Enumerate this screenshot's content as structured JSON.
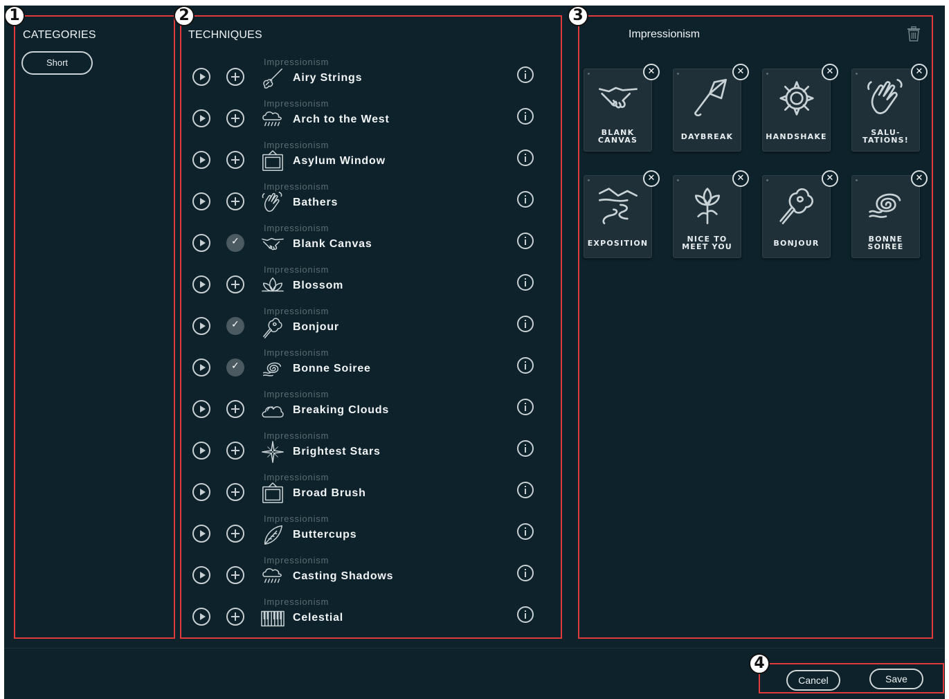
{
  "categories": {
    "title": "CATEGORIES",
    "items": [
      "Short"
    ]
  },
  "techniques": {
    "title": "TECHNIQUES",
    "rows": [
      {
        "category": "Impressionism",
        "name": "Airy Strings",
        "icon": "violin-icon",
        "added": false
      },
      {
        "category": "Impressionism",
        "name": "Arch to the West",
        "icon": "rain-cloud-icon",
        "added": false
      },
      {
        "category": "Impressionism",
        "name": "Asylum Window",
        "icon": "picture-frame-icon",
        "added": false
      },
      {
        "category": "Impressionism",
        "name": "Bathers",
        "icon": "waving-hand-icon",
        "added": false
      },
      {
        "category": "Impressionism",
        "name": "Blank Canvas",
        "icon": "handshake-icon",
        "added": true
      },
      {
        "category": "Impressionism",
        "name": "Blossom",
        "icon": "lotus-icon",
        "added": false
      },
      {
        "category": "Impressionism",
        "name": "Bonjour",
        "icon": "bouquet-icon",
        "added": true
      },
      {
        "category": "Impressionism",
        "name": "Bonne Soiree",
        "icon": "swirl-icon",
        "added": true
      },
      {
        "category": "Impressionism",
        "name": "Breaking Clouds",
        "icon": "cloud-icon",
        "added": false
      },
      {
        "category": "Impressionism",
        "name": "Brightest Stars",
        "icon": "star-icon",
        "added": false
      },
      {
        "category": "Impressionism",
        "name": "Broad Brush",
        "icon": "picture-frame-icon",
        "added": false
      },
      {
        "category": "Impressionism",
        "name": "Buttercups",
        "icon": "leaf-icon",
        "added": false
      },
      {
        "category": "Impressionism",
        "name": "Casting Shadows",
        "icon": "rain-cloud-icon",
        "added": false
      },
      {
        "category": "Impressionism",
        "name": "Celestial",
        "icon": "piano-keys-icon",
        "added": false
      }
    ]
  },
  "selection": {
    "title": "Impressionism",
    "tiles": [
      {
        "label": [
          "BLANK",
          "CANVAS"
        ],
        "icon": "handshake-icon"
      },
      {
        "label": [
          "DAYBREAK"
        ],
        "icon": "umbrella-icon"
      },
      {
        "label": [
          "HANDSHAKE"
        ],
        "icon": "sunflower-icon"
      },
      {
        "label": [
          "SALU-",
          "TATIONS!"
        ],
        "icon": "waving-hand-icon"
      },
      {
        "label": [
          "EXPOSITION"
        ],
        "icon": "landscape-river-icon"
      },
      {
        "label": [
          "NICE TO",
          "MEET YOU"
        ],
        "icon": "iris-flower-icon"
      },
      {
        "label": [
          "BONJOUR"
        ],
        "icon": "bouquet-icon"
      },
      {
        "label": [
          "BONNE",
          "SOIREE"
        ],
        "icon": "swirl-icon"
      }
    ]
  },
  "footer": {
    "cancel_label": "Cancel",
    "save_label": "Save"
  },
  "annotations": [
    "1",
    "2",
    "3",
    "4"
  ]
}
